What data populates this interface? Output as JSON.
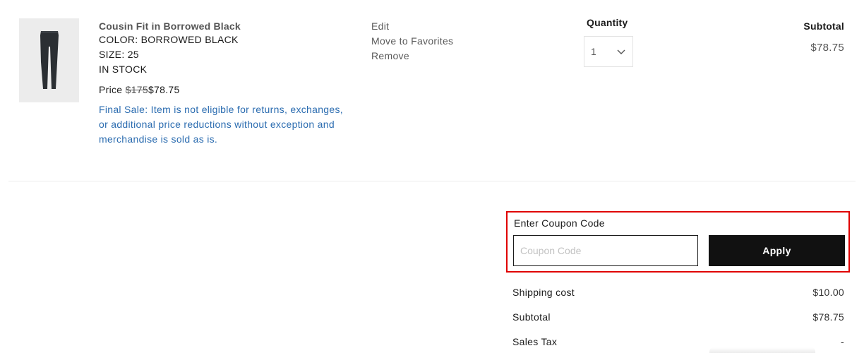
{
  "product": {
    "name": "Cousin Fit in Borrowed Black",
    "color_line": "COLOR: BORROWED BLACK",
    "size_line": "SIZE: 25",
    "stock_line": "IN STOCK",
    "price_prefix": "Price",
    "original_price": "$175",
    "sale_price": "$78.75",
    "final_sale_note": "Final Sale: Item is not eligible for returns, exchanges, or additional price reductions without exception and merchandise is sold as is.",
    "image_icon": "jeans-thumbnail"
  },
  "actions": {
    "edit": "Edit",
    "move_to_favorites": "Move to Favorites",
    "remove": "Remove"
  },
  "quantity": {
    "label": "Quantity",
    "value": "1"
  },
  "line_subtotal": {
    "label": "Subtotal",
    "value": "$78.75"
  },
  "coupon": {
    "label": "Enter Coupon Code",
    "placeholder": "Coupon Code",
    "value": "",
    "apply_label": "Apply",
    "highlight_color": "#e00000"
  },
  "summary": {
    "shipping_label": "Shipping cost",
    "shipping_value": "$10.00",
    "subtotal_label": "Subtotal",
    "subtotal_value": "$78.75",
    "tax_label": "Sales Tax",
    "tax_value": "-"
  },
  "colors": {
    "link_blue": "#2b6cb0",
    "button_black": "#111111"
  }
}
